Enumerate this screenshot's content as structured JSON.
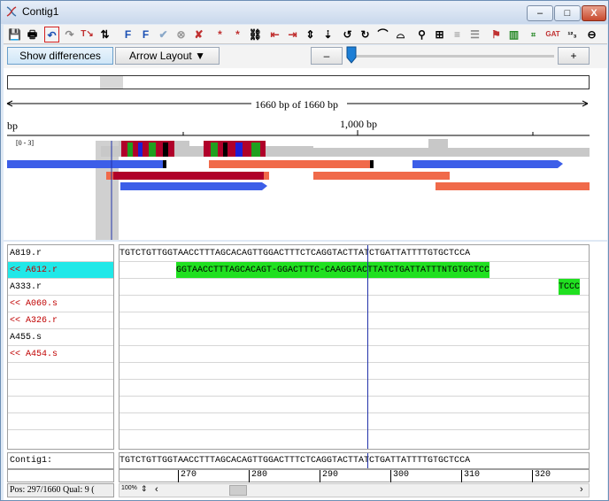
{
  "window": {
    "title": "Contig1"
  },
  "window_buttons": {
    "minimize": "–",
    "maximize": "□",
    "close": "X"
  },
  "controls": {
    "show_differences": "Show differences",
    "arrow_layout": "Arrow Layout ▼",
    "zoom_out": "–",
    "zoom_in": "+"
  },
  "overview": {
    "length_label": "1660 bp of 1660 bp",
    "ruler_start": "bp",
    "ruler_mid": "1,000 bp",
    "coverage_label": "[0 - 3]"
  },
  "reads": [
    {
      "name": "A819.r",
      "color": "#000000"
    },
    {
      "name": "<< A612.r",
      "color": "#c00000"
    },
    {
      "name": "A333.r",
      "color": "#000000"
    },
    {
      "name": "<< A060.s",
      "color": "#c00000"
    },
    {
      "name": "<< A326.r",
      "color": "#c00000"
    },
    {
      "name": "A455.s",
      "color": "#000000"
    },
    {
      "name": "<< A454.s",
      "color": "#c00000"
    }
  ],
  "sequences": {
    "a819": "TGTCTGTTGGTAACCTTTAGCACAGTTGGACTTTCTCAGGTACTTATCTGATTATTTTGTGCTCCA",
    "a612": "GGTAACCTTTAGCACAGT-GGACTTTC-CAAGGTACTTATCTGATTATTTNTGTGCTCC",
    "a333": "TCCC",
    "contig": "TGTCTGTTGGTAACCTTTAGCACAGTTGGACTTTCTCAGGTACTTATCTGATTATTTTGTGCTCCA"
  },
  "contig_label": "Contig1:",
  "ruler_ticks": [
    "270",
    "280",
    "290",
    "300",
    "310",
    "320"
  ],
  "status": {
    "text": "Pos: 297/1660  Qual: 9 (",
    "zoom": "100%"
  },
  "icons": [
    "save-icon",
    "print-icon",
    "undo-icon",
    "redo-icon",
    "translate-icon",
    "sort-icon",
    "forward-icon",
    "backward-icon",
    "check-icon",
    "cancel-icon",
    "delete-icon",
    "star-icon",
    "binoculars-icon"
  ]
}
